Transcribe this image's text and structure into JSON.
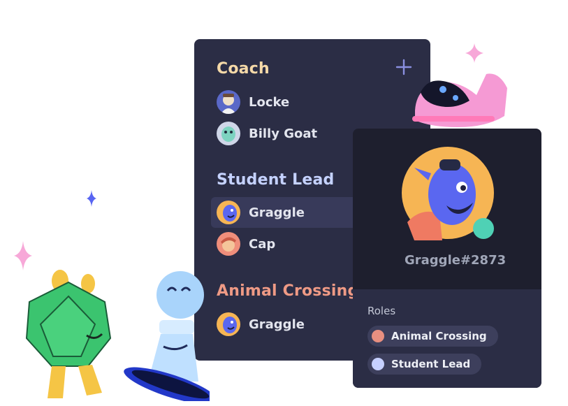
{
  "members_panel": {
    "groups": [
      {
        "role": "Coach",
        "color": "#f5d9a8",
        "members": [
          {
            "name": "Locke",
            "avatar": "locke-avatar"
          },
          {
            "name": "Billy Goat",
            "avatar": "billy-goat-avatar"
          }
        ]
      },
      {
        "role": "Student Lead",
        "color": "#c5d2ff",
        "members": [
          {
            "name": "Graggle",
            "avatar": "graggle-avatar"
          },
          {
            "name": "Cap",
            "avatar": "cap-avatar"
          }
        ]
      },
      {
        "role": "Animal Crossing",
        "color": "#ef9a85",
        "members": [
          {
            "name": "Graggle",
            "avatar": "graggle-avatar"
          }
        ]
      }
    ],
    "add_icon": "plus-icon"
  },
  "profile": {
    "tag": "Graggle#2873",
    "roles_label": "Roles",
    "roles": [
      {
        "name": "Animal Crossing",
        "color": "#e88f80"
      },
      {
        "name": "Student Lead",
        "color": "#c6d0ff"
      }
    ],
    "status_color": "#4fd1b5"
  }
}
